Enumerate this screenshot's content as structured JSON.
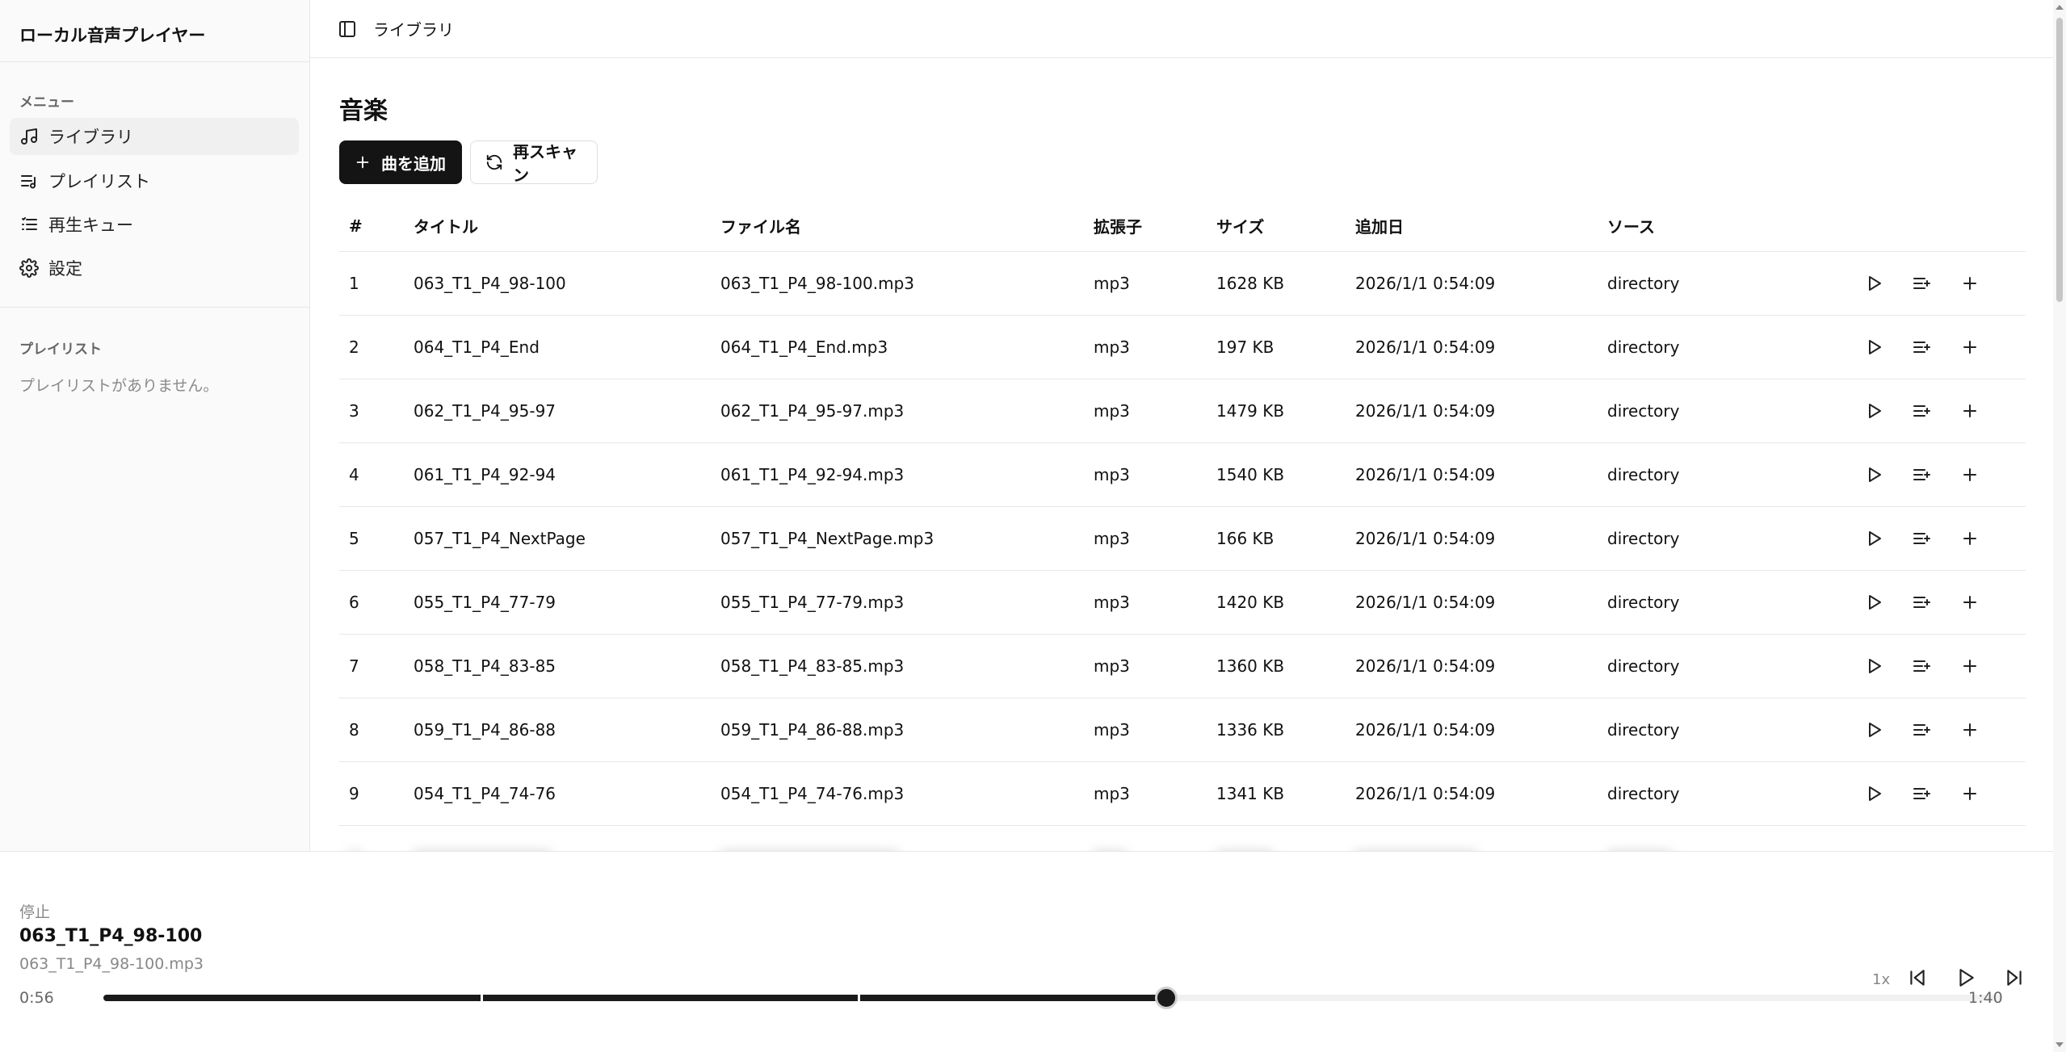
{
  "app": {
    "title": "ローカル音声プレイヤー"
  },
  "sidebar": {
    "menu_heading": "メニュー",
    "items": [
      {
        "label": "ライブラリ",
        "icon": "music-note-icon",
        "active": true
      },
      {
        "label": "プレイリスト",
        "icon": "playlist-icon",
        "active": false
      },
      {
        "label": "再生キュー",
        "icon": "list-icon",
        "active": false
      },
      {
        "label": "設定",
        "icon": "gear-icon",
        "active": false
      }
    ],
    "playlist_heading": "プレイリスト",
    "playlist_empty": "プレイリストがありません。"
  },
  "header": {
    "breadcrumb": "ライブラリ",
    "icon": "sidebar-toggle-icon"
  },
  "main": {
    "title": "音楽",
    "add_button": "曲を追加",
    "rescan_button": "再スキャン",
    "table": {
      "headers": {
        "num": "#",
        "title": "タイトル",
        "file": "ファイル名",
        "ext": "拡張子",
        "size": "サイズ",
        "date": "追加日",
        "source": "ソース"
      },
      "rows": [
        {
          "num": "1",
          "title": "063_T1_P4_98-100",
          "file": "063_T1_P4_98-100.mp3",
          "ext": "mp3",
          "size": "1628 KB",
          "date": "2026/1/1 0:54:09",
          "source": "directory"
        },
        {
          "num": "2",
          "title": "064_T1_P4_End",
          "file": "064_T1_P4_End.mp3",
          "ext": "mp3",
          "size": "197 KB",
          "date": "2026/1/1 0:54:09",
          "source": "directory"
        },
        {
          "num": "3",
          "title": "062_T1_P4_95-97",
          "file": "062_T1_P4_95-97.mp3",
          "ext": "mp3",
          "size": "1479 KB",
          "date": "2026/1/1 0:54:09",
          "source": "directory"
        },
        {
          "num": "4",
          "title": "061_T1_P4_92-94",
          "file": "061_T1_P4_92-94.mp3",
          "ext": "mp3",
          "size": "1540 KB",
          "date": "2026/1/1 0:54:09",
          "source": "directory"
        },
        {
          "num": "5",
          "title": "057_T1_P4_NextPage",
          "file": "057_T1_P4_NextPage.mp3",
          "ext": "mp3",
          "size": "166 KB",
          "date": "2026/1/1 0:54:09",
          "source": "directory"
        },
        {
          "num": "6",
          "title": "055_T1_P4_77-79",
          "file": "055_T1_P4_77-79.mp3",
          "ext": "mp3",
          "size": "1420 KB",
          "date": "2026/1/1 0:54:09",
          "source": "directory"
        },
        {
          "num": "7",
          "title": "058_T1_P4_83-85",
          "file": "058_T1_P4_83-85.mp3",
          "ext": "mp3",
          "size": "1360 KB",
          "date": "2026/1/1 0:54:09",
          "source": "directory"
        },
        {
          "num": "8",
          "title": "059_T1_P4_86-88",
          "file": "059_T1_P4_86-88.mp3",
          "ext": "mp3",
          "size": "1336 KB",
          "date": "2026/1/1 0:54:09",
          "source": "directory"
        },
        {
          "num": "9",
          "title": "054_T1_P4_74-76",
          "file": "054_T1_P4_74-76.mp3",
          "ext": "mp3",
          "size": "1341 KB",
          "date": "2026/1/1 0:54:09",
          "source": "directory"
        }
      ],
      "row_actions": [
        "play-icon",
        "add-to-queue-icon",
        "plus-icon"
      ]
    }
  },
  "player": {
    "status": "停止",
    "title": "063_T1_P4_98-100",
    "file": "063_T1_P4_98-100.mp3",
    "elapsed": "0:56",
    "total": "1:40",
    "progress": 0.56,
    "speed": "1x"
  },
  "colors": {
    "accent": "#141414",
    "border": "#e7e7e7",
    "muted_text": "#888888",
    "sidebar_bg": "#fafafa"
  }
}
